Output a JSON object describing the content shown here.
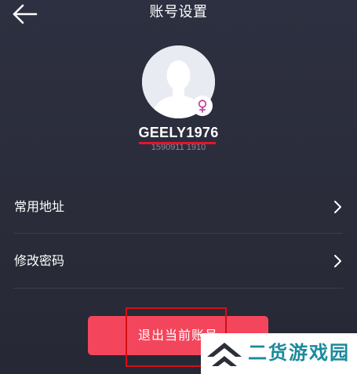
{
  "header": {
    "title": "账号设置",
    "back_icon": "arrow-left-icon"
  },
  "profile": {
    "avatar_icon": "default-avatar-icon",
    "gender_icon": "female-icon",
    "gender_color": "#c7479b",
    "username": "GEELY1976",
    "phone": "1590911 1910"
  },
  "menu": {
    "items": [
      {
        "label": "常用地址",
        "icon": "chevron-right-icon"
      },
      {
        "label": "修改密码",
        "icon": "chevron-right-icon"
      }
    ]
  },
  "actions": {
    "logout_label": "退出当前账号",
    "logout_color": "#f3465c"
  },
  "watermark": {
    "text": "二货游戏园",
    "color": "#1b8a9c"
  },
  "annotation": {
    "highlight_color": "#d40f14",
    "redaction_color": "#e8122a"
  }
}
